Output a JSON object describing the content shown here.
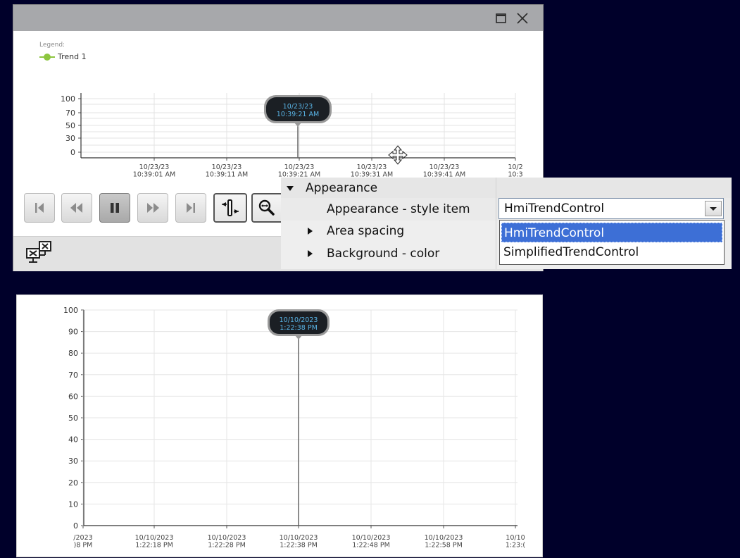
{
  "top_trend": {
    "legend": {
      "title": "Legend:",
      "items": [
        {
          "label": "Trend 1",
          "color": "#8dc63f"
        }
      ]
    },
    "y_ticks": [
      "100",
      "70",
      "50",
      "30",
      "0"
    ],
    "x_ticks": [
      {
        "date": "10/23/23",
        "time": "10:39:01 AM"
      },
      {
        "date": "10/23/23",
        "time": "10:39:11 AM"
      },
      {
        "date": "10/23/23",
        "time": "10:39:21 AM"
      },
      {
        "date": "10/23/23",
        "time": "10:39:31 AM"
      },
      {
        "date": "10/23/23",
        "time": "10:39:41 AM"
      },
      {
        "date": "10/2",
        "time": "10:3"
      }
    ],
    "ruler_tooltip": {
      "date": "10/23/23",
      "time": "10:39:21 AM"
    },
    "window_icons": [
      "maximize-icon",
      "close-icon"
    ],
    "toolbar_icons": [
      "first-icon",
      "rewind-icon",
      "pause-icon",
      "forward-icon",
      "last-icon",
      "ruler-icon",
      "zoom-icon"
    ],
    "status_icon": "network-disconnected-icon"
  },
  "properties": {
    "group_label": "Appearance",
    "style_item_label": "Appearance - style item",
    "style_item_value": "HmiTrendControl",
    "area_spacing_label": "Area spacing",
    "background_color_label": "Background - color",
    "dropdown_options": [
      "HmiTrendControl",
      "SimplifiedTrendControl"
    ],
    "selected_option": "HmiTrendControl"
  },
  "bottom_trend": {
    "y_ticks": [
      "100",
      "90",
      "80",
      "70",
      "60",
      "50",
      "40",
      "30",
      "20",
      "10",
      "0"
    ],
    "x_ticks": [
      {
        "date": "/2023",
        "time": ")8 PM"
      },
      {
        "date": "10/10/2023",
        "time": "1:22:18 PM"
      },
      {
        "date": "10/10/2023",
        "time": "1:22:28 PM"
      },
      {
        "date": "10/10/2023",
        "time": "1:22:38 PM"
      },
      {
        "date": "10/10/2023",
        "time": "1:22:48 PM"
      },
      {
        "date": "10/10/2023",
        "time": "1:22:58 PM"
      },
      {
        "date": "10/10",
        "time": "1:23:("
      }
    ],
    "ruler_tooltip": {
      "date": "10/10/2023",
      "time": "1:22:38 PM"
    }
  },
  "colors": {
    "background": "#00002a",
    "tooltip_text": "#59b4e6",
    "selection": "#3d6fd6",
    "trend": "#8dc63f"
  }
}
